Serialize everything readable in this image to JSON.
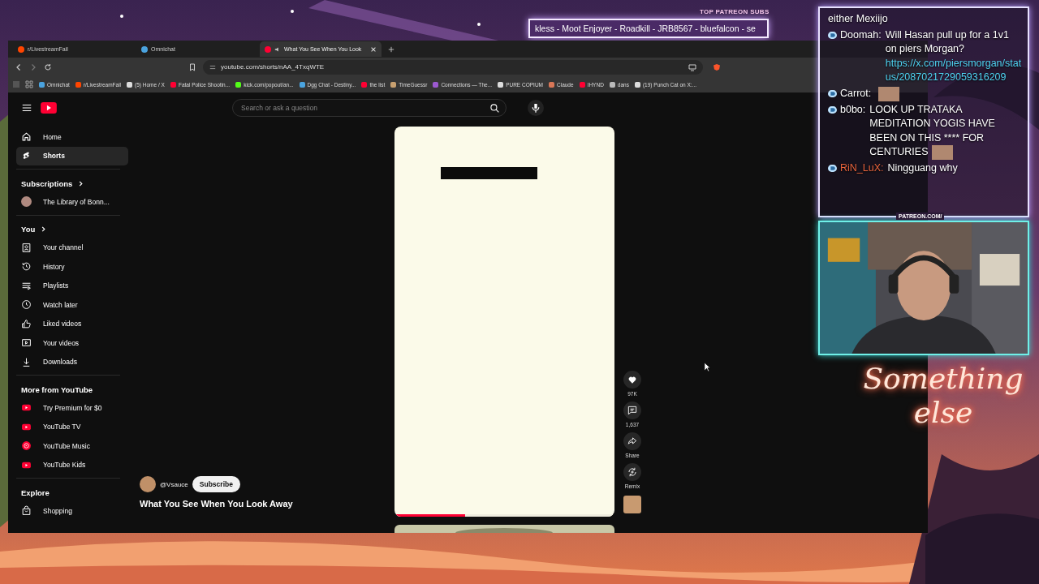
{
  "overlay": {
    "patreon_label": "TOP PATREON SUBS",
    "ticker": "kless - Moot Enjoyer - Roadkill - JRB8567 - bluefalcon - se",
    "patreon_url": "PATREON.COM/",
    "logo": "Something else"
  },
  "chat": [
    {
      "kind": "continuation",
      "text": "either Mexiijo"
    },
    {
      "kind": "message",
      "user": "Doomah:",
      "color": "#ffffff",
      "text": "Will Hasan pull up for a 1v1 on piers Morgan?",
      "link": "https://x.com/piersmorgan/status/2087021729059316209"
    },
    {
      "kind": "emote",
      "user": "Carrot:",
      "color": "#ffffff"
    },
    {
      "kind": "message",
      "user": "b0bo:",
      "color": "#ffffff",
      "text": "LOOK UP TRATAKA MEDITATION YOGIS HAVE BEEN ON THIS **** FOR CENTURIES",
      "emote": true
    },
    {
      "kind": "message",
      "user": "RiN_LuX:",
      "color": "#e8643c",
      "text": "Ningguang why"
    }
  ],
  "browser": {
    "tabs": [
      {
        "title": "r/LivestreamFail",
        "selected": false,
        "audio": false,
        "color": "#ff4500"
      },
      {
        "title": "Omnichat",
        "selected": false,
        "audio": false,
        "color": "#4aa3df"
      },
      {
        "title": "What You See When You Look",
        "selected": true,
        "audio": true,
        "color": "#ff0033"
      }
    ],
    "address": "youtube.com/shorts/nAA_4TxqWTE",
    "bookmarks": [
      {
        "title": "Omnichat",
        "color": "#4aa3df"
      },
      {
        "title": "r/LivestreamFail",
        "color": "#ff4500"
      },
      {
        "title": "(5) Home / X",
        "color": "#dddddd"
      },
      {
        "title": "Fatal Police Shootin...",
        "color": "#ff0033"
      },
      {
        "title": "kick.com/popout/an...",
        "color": "#53fc18"
      },
      {
        "title": "Dgg Chat - Destiny...",
        "color": "#4aa3df"
      },
      {
        "title": "the list",
        "color": "#ff0033"
      },
      {
        "title": "TimeGuessr",
        "color": "#c8a070"
      },
      {
        "title": "Connections — The...",
        "color": "#9b59d0"
      },
      {
        "title": "PURE COPIUM",
        "color": "#dddddd"
      },
      {
        "title": "Claude",
        "color": "#d97757"
      },
      {
        "title": "IHYND",
        "color": "#ff0033"
      },
      {
        "title": "dans",
        "color": "#bbbbbb"
      },
      {
        "title": "(19) Punch Cat on X:...",
        "color": "#dddddd"
      }
    ]
  },
  "youtube": {
    "search": {
      "placeholder": "Search or ask a question"
    },
    "sidebar": {
      "main": [
        {
          "label": "Home",
          "selected": false
        },
        {
          "label": "Shorts",
          "selected": true
        }
      ],
      "subscriptions": {
        "title": "Subscriptions",
        "items": [
          {
            "label": "The Library of Bonn..."
          }
        ]
      },
      "you": {
        "title": "You",
        "items": [
          {
            "label": "Your channel"
          },
          {
            "label": "History"
          },
          {
            "label": "Playlists"
          },
          {
            "label": "Watch later"
          },
          {
            "label": "Liked videos"
          },
          {
            "label": "Your videos"
          },
          {
            "label": "Downloads"
          }
        ]
      },
      "more": {
        "title": "More from YouTube",
        "items": [
          {
            "label": "Try Premium for $0"
          },
          {
            "label": "YouTube TV"
          },
          {
            "label": "YouTube Music"
          },
          {
            "label": "YouTube Kids"
          }
        ]
      },
      "explore": {
        "title": "Explore",
        "items": [
          {
            "label": "Shopping"
          }
        ]
      }
    },
    "short": {
      "channel": "@Vsauce",
      "subscribe": "Subscribe",
      "title": "What You See When You Look Away",
      "progress": {
        "level": 0.32
      },
      "actions": [
        {
          "label": "97K"
        },
        {
          "label": "1,637"
        },
        {
          "label": "Share"
        },
        {
          "label": "Remix"
        }
      ]
    }
  }
}
